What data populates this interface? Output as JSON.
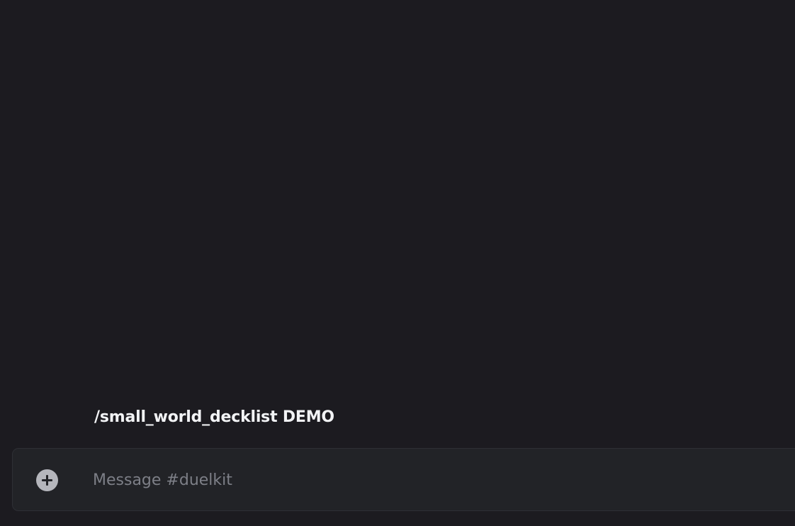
{
  "command_preview": {
    "text": "/small_world_decklist DEMO"
  },
  "composer": {
    "placeholder": "Message #duelkit",
    "value": "",
    "add_icon": "plus-circle-icon"
  },
  "colors": {
    "background": "#1c1b20",
    "composer_background": "#222327",
    "text": "#f2f3f5",
    "placeholder": "#7d7f87",
    "icon": "#b5b6bc"
  }
}
